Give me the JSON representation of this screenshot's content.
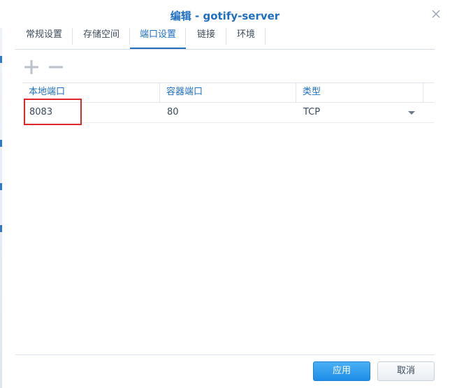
{
  "window": {
    "title": "编辑 - gotify-server"
  },
  "tabs": [
    {
      "label": "常规设置",
      "active": false
    },
    {
      "label": "存储空间",
      "active": false
    },
    {
      "label": "端口设置",
      "active": true
    },
    {
      "label": "链接",
      "active": false
    },
    {
      "label": "环境",
      "active": false
    }
  ],
  "toolbar": {
    "add_icon": "plus-icon",
    "remove_icon": "minus-icon"
  },
  "grid": {
    "columns": [
      "本地端口",
      "容器端口",
      "类型"
    ],
    "rows": [
      {
        "local_port": "8083",
        "container_port": "80",
        "type": "TCP"
      }
    ]
  },
  "footer": {
    "apply_label": "应用",
    "cancel_label": "取消"
  },
  "colors": {
    "accent": "#1f6fc0",
    "highlight": "#e02626",
    "primary_button": "#1f8ee8"
  }
}
